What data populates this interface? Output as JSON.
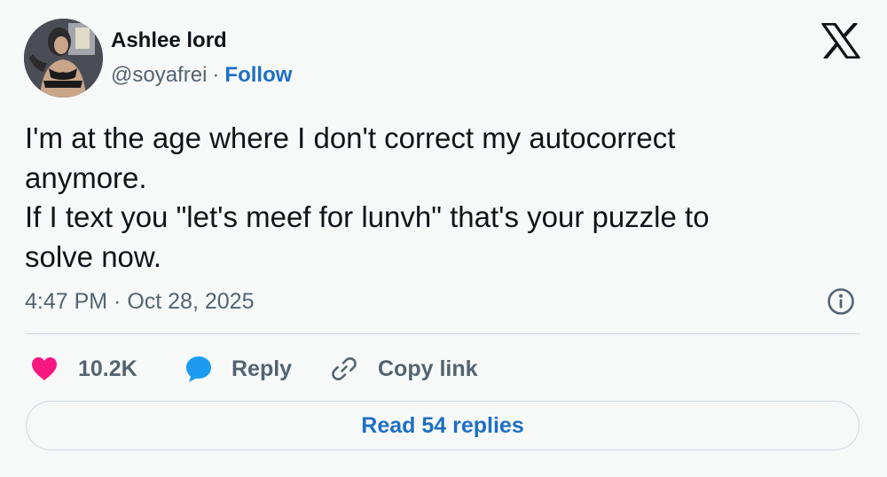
{
  "author": {
    "display_name": "Ashlee lord",
    "handle": "@soyafrei",
    "separator": "·",
    "follow_label": "Follow"
  },
  "tweet": {
    "text": "I'm at the age where I don't correct my autocorrect\nanymore.\nIf I text you \"let's meef for lunvh\" that's your puzzle to\nsolve now.",
    "timestamp": "4:47 PM · Oct 28, 2025"
  },
  "actions": {
    "like_count": "10.2K",
    "reply_label": "Reply",
    "copy_link_label": "Copy link"
  },
  "footer": {
    "read_replies_label": "Read 54 replies"
  },
  "icons": {
    "brand": "x-logo-icon",
    "info": "info-icon",
    "like": "heart-icon",
    "reply": "speech-bubble-icon",
    "copy_link": "link-icon"
  },
  "colors": {
    "background": "#f7f9f9",
    "text": "#0f1419",
    "secondary_text": "#536471",
    "link_blue": "#1d6fc4",
    "heart": "#f91880",
    "reply_bubble": "#1d9bf0",
    "divider": "#cfd9de"
  }
}
